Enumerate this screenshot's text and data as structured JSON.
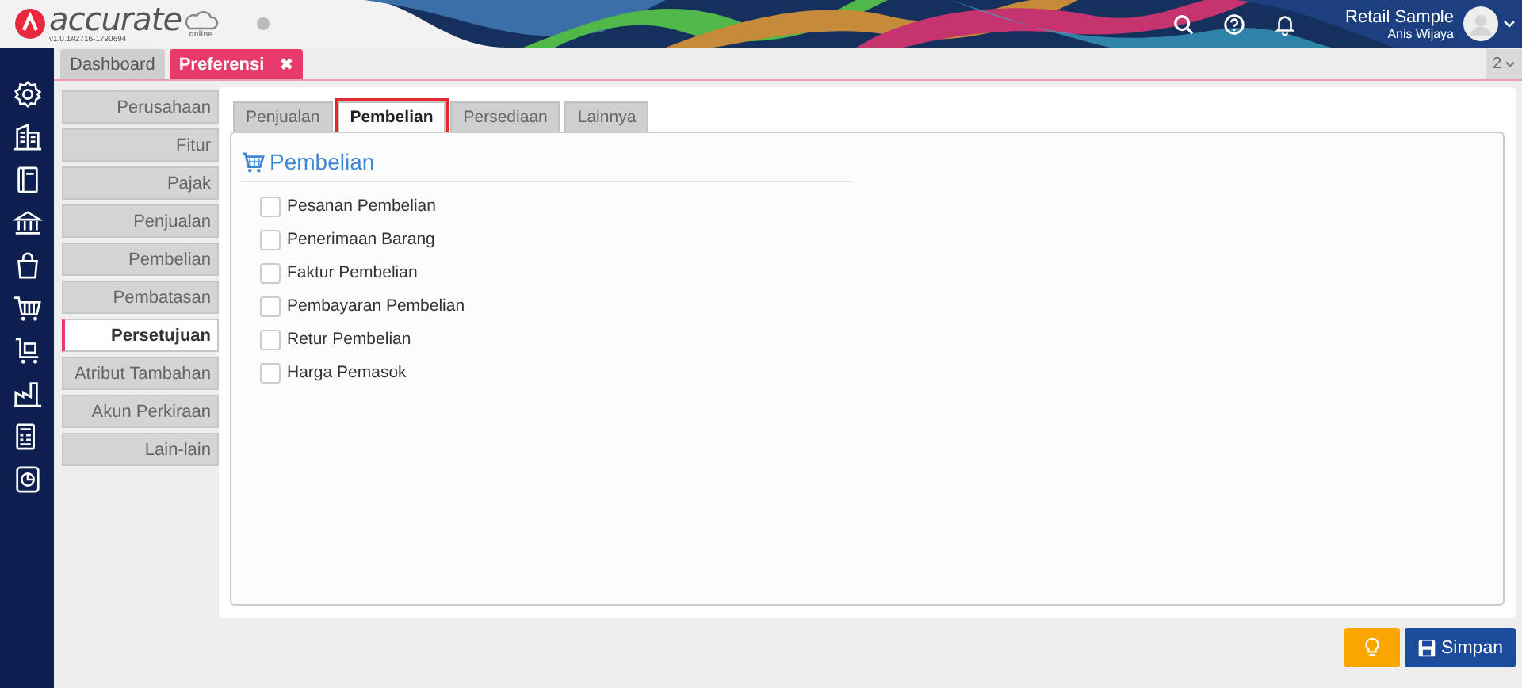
{
  "header": {
    "logo_text": "accurate",
    "logo_sub": "online",
    "version": "v1.0.1#2716-1790694",
    "company": "Retail Sample",
    "user": "Anis Wijaya"
  },
  "doc_tabs": [
    {
      "label": "Dashboard",
      "selected": false
    },
    {
      "label": "Preferensi",
      "selected": true,
      "close": "✖"
    }
  ],
  "tab_counter": "2",
  "menu": [
    {
      "label": "Perusahaan",
      "selected": false
    },
    {
      "label": "Fitur",
      "selected": false
    },
    {
      "label": "Pajak",
      "selected": false
    },
    {
      "label": "Penjualan",
      "selected": false
    },
    {
      "label": "Pembelian",
      "selected": false
    },
    {
      "label": "Pembatasan",
      "selected": false
    },
    {
      "label": "Persetujuan",
      "selected": true
    },
    {
      "label": "Atribut Tambahan",
      "selected": false
    },
    {
      "label": "Akun Perkiraan",
      "selected": false
    },
    {
      "label": "Lain-lain",
      "selected": false
    }
  ],
  "tabs": [
    {
      "label": "Penjualan",
      "selected": false,
      "highlighted": false
    },
    {
      "label": "Pembelian",
      "selected": true,
      "highlighted": true
    },
    {
      "label": "Persediaan",
      "selected": false,
      "highlighted": false
    },
    {
      "label": "Lainnya",
      "selected": false,
      "highlighted": false
    }
  ],
  "section_title": "Pembelian",
  "options": [
    {
      "label": "Pesanan Pembelian",
      "checked": false
    },
    {
      "label": "Penerimaan Barang",
      "checked": false
    },
    {
      "label": "Faktur Pembelian",
      "checked": false
    },
    {
      "label": "Pembayaran Pembelian",
      "checked": false
    },
    {
      "label": "Retur Pembelian",
      "checked": false
    },
    {
      "label": "Harga Pemasok",
      "checked": false
    }
  ],
  "save_button": "Simpan"
}
